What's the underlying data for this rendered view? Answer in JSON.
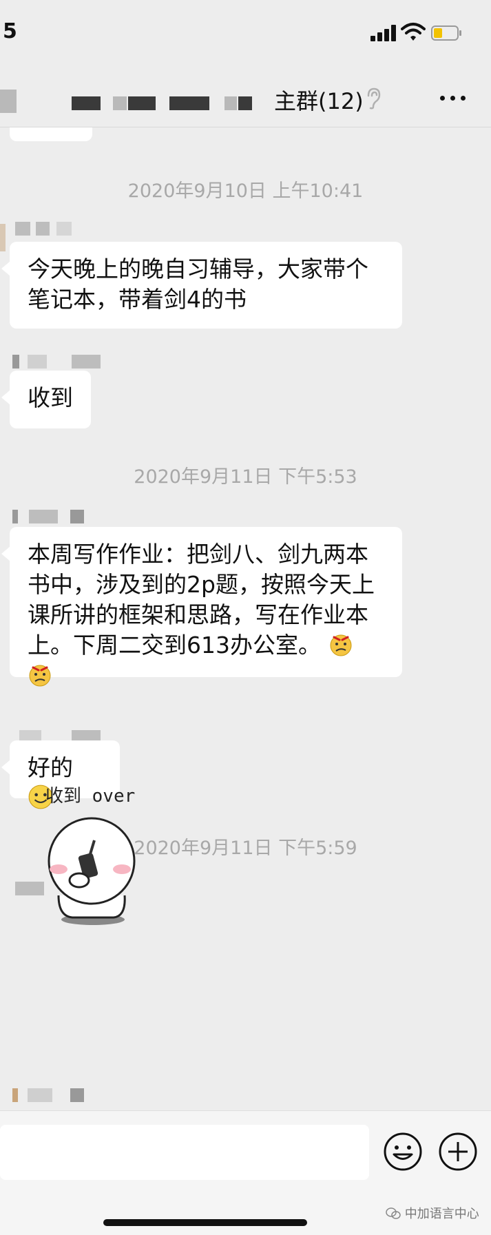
{
  "status_bar": {
    "time": "5"
  },
  "nav": {
    "title": "主群(12)",
    "icons": [
      "ear-icon",
      "more-icon"
    ]
  },
  "chat": {
    "messages": [
      {
        "type": "timestamp",
        "text": "2020年9月10日 上午10:41"
      },
      {
        "type": "text",
        "text": "今天晚上的晚自习辅导，大家带个笔记本，带着剑4的书"
      },
      {
        "type": "text",
        "text": "收到"
      },
      {
        "type": "timestamp",
        "text": "2020年9月11日 下午5:53"
      },
      {
        "type": "text",
        "text": "本周写作作业：把剑八、剑九两本书中，涉及到的2p题，按照今天上课所讲的框架和思路，写在作业本上。下周二交到613办公室。",
        "emoji": "frowning-face-emoji"
      },
      {
        "type": "text",
        "text": "好的",
        "emoji": "smiling-face-emoji"
      },
      {
        "type": "timestamp",
        "text": "2020年9月11日 下午5:59"
      },
      {
        "type": "sticker",
        "caption": "收到 over",
        "icon": "walkie-talkie-sticker"
      }
    ]
  },
  "input_bar": {
    "placeholder": "",
    "watermark": "中加语言中心"
  }
}
